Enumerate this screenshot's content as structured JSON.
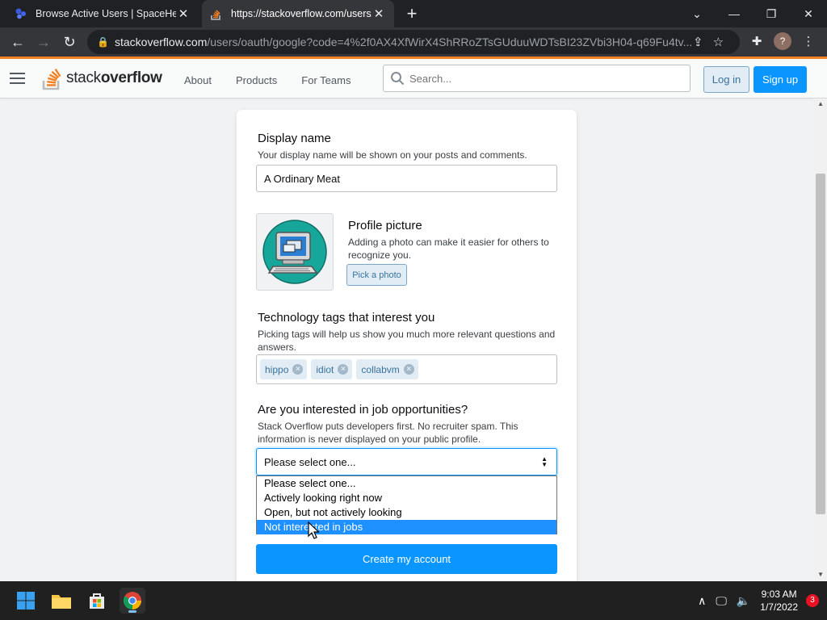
{
  "browser": {
    "tabs": [
      {
        "title": "Browse Active Users | SpaceHey",
        "active": false
      },
      {
        "title": "https://stackoverflow.com/users/",
        "active": true
      }
    ],
    "url_host": "stackoverflow.com",
    "url_path": "/users/oauth/google?code=4%2f0AX4XfWirX4ShRRoZTsGUduuWDTsBI23ZVbi3H04-q69Fu4tv...",
    "profile_initial": "?"
  },
  "header": {
    "logo_light": "stack",
    "logo_bold": "overflow",
    "nav": [
      "About",
      "Products",
      "For Teams"
    ],
    "search_placeholder": "Search...",
    "login_label": "Log in",
    "signup_label": "Sign up"
  },
  "form": {
    "display_name": {
      "label": "Display name",
      "description": "Your display name will be shown on your posts and comments.",
      "value": "A Ordinary Meat"
    },
    "profile_picture": {
      "label": "Profile picture",
      "description": "Adding a photo can make it easier for others to recognize you.",
      "button": "Pick a photo"
    },
    "tags": {
      "label": "Technology tags that interest you",
      "description": "Picking tags will help us show you much more relevant questions and answers.",
      "items": [
        "hippo",
        "idiot",
        "collabvm"
      ]
    },
    "jobs": {
      "label": "Are you interested in job opportunities?",
      "description": "Stack Overflow puts developers first. No recruiter spam. This information is never displayed on your public profile.",
      "selected": "Please select one...",
      "options": [
        "Please select one...",
        "Actively looking right now",
        "Open, but not actively looking",
        "Not interested in jobs"
      ],
      "highlighted_option": "Not interested in jobs"
    },
    "submit_label": "Create my account"
  },
  "taskbar": {
    "time": "9:03 AM",
    "date": "1/7/2022",
    "notification_count": "3"
  },
  "colors": {
    "so_orange": "#f48024",
    "so_blue": "#0a95ff",
    "tag_bg": "#e1ecf4",
    "tag_text": "#39739d"
  }
}
